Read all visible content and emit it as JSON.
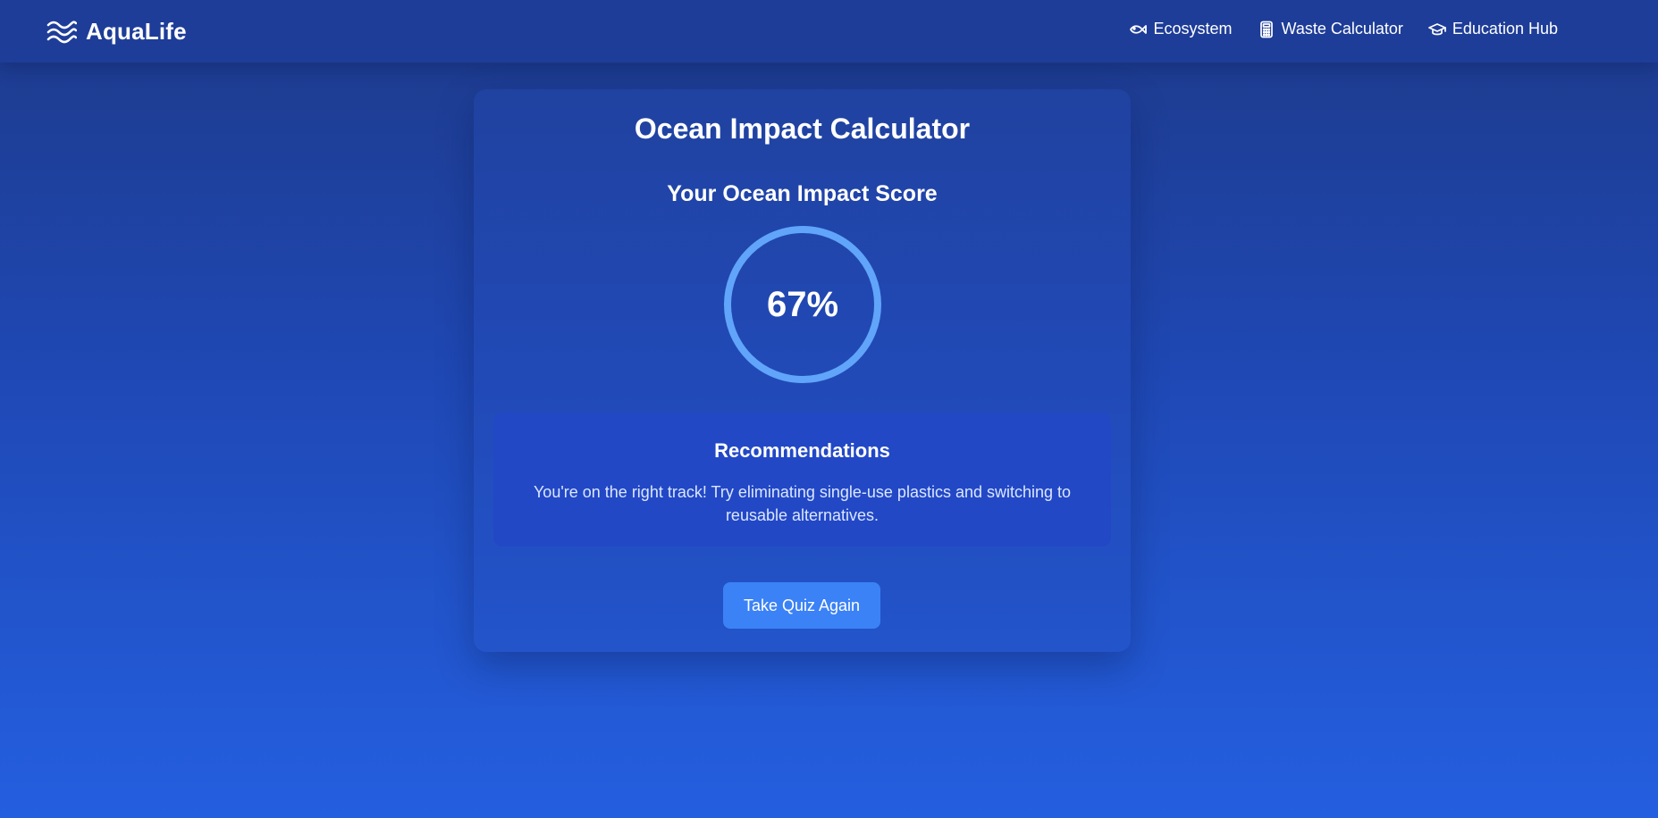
{
  "header": {
    "brand": "AquaLife",
    "nav": [
      {
        "label": "Ecosystem",
        "icon": "fish-icon"
      },
      {
        "label": "Waste Calculator",
        "icon": "calculator-icon"
      },
      {
        "label": "Education Hub",
        "icon": "graduation-cap-icon"
      }
    ]
  },
  "main": {
    "title": "Ocean Impact Calculator",
    "score_heading": "Your Ocean Impact Score",
    "score_text": "67%",
    "score_percent": 67,
    "recommendations": {
      "title": "Recommendations",
      "text": "You're on the right track! Try eliminating single-use plastics and switching to reusable alternatives."
    },
    "cta_label": "Take Quiz Again"
  },
  "colors": {
    "background_top": "#1e3a8a",
    "background_bottom": "#245fe0",
    "accent": "#3b82f6",
    "ring": "#60a5fa",
    "recommendation_panel": "#2248c6"
  }
}
